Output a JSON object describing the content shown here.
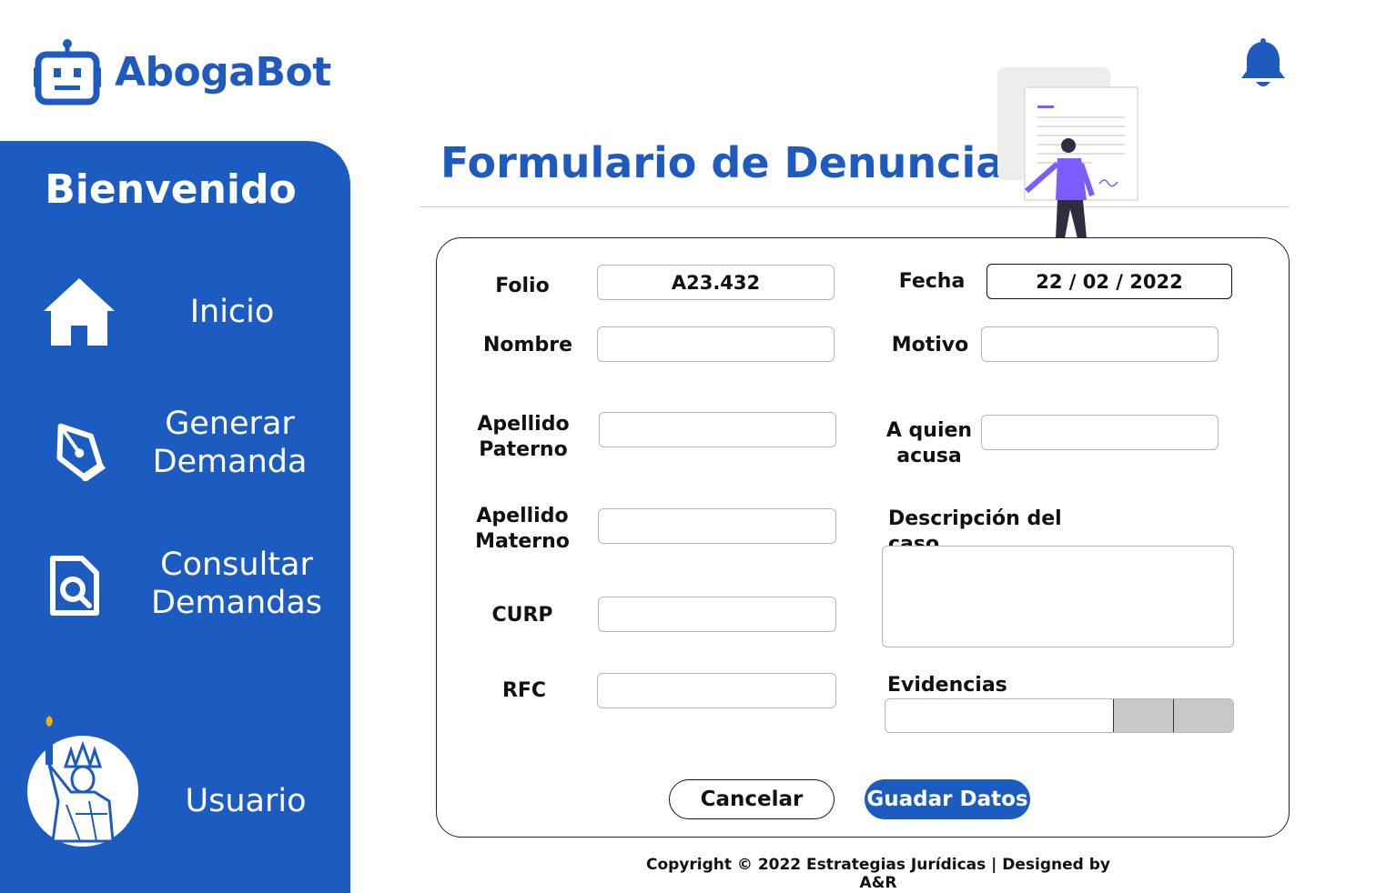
{
  "app": {
    "name": "AbogaBot"
  },
  "sidebar": {
    "welcome": "Bienvenido",
    "items": [
      {
        "label": "Inicio",
        "icon": "home-icon"
      },
      {
        "label": "Generar\nDemanda",
        "icon": "pen-nib-icon"
      },
      {
        "label": "Consultar\nDemandas",
        "icon": "document-search-icon"
      },
      {
        "label": "Usuario",
        "icon": "statue-of-liberty-avatar"
      }
    ]
  },
  "page": {
    "title": "Formulario de Denuncia"
  },
  "form": {
    "folio": {
      "label": "Folio",
      "value": "A23.432"
    },
    "fecha": {
      "label": "Fecha",
      "value": "22 / 02 / 2022"
    },
    "nombre": {
      "label": "Nombre",
      "value": ""
    },
    "motivo": {
      "label": "Motivo",
      "value": ""
    },
    "apellido_paterno": {
      "label": "Apellido\nPaterno",
      "value": ""
    },
    "a_quien_acusa": {
      "label": "A quien\nacusa",
      "value": ""
    },
    "apellido_materno": {
      "label": "Apellido\nMaterno",
      "value": ""
    },
    "descripcion": {
      "label": "Descripción del caso",
      "value": ""
    },
    "curp": {
      "label": "CURP",
      "value": ""
    },
    "rfc": {
      "label": "RFC",
      "value": ""
    },
    "evidencias": {
      "label": "Evidencias"
    }
  },
  "buttons": {
    "cancel": "Cancelar",
    "save": "Guadar Datos"
  },
  "footer": {
    "copyright": "Copyright © 2022 Estrategias Jurídicas | Designed by A&R"
  },
  "colors": {
    "brand": "#1c5bc0",
    "illustration_accent": "#7c5cff"
  }
}
